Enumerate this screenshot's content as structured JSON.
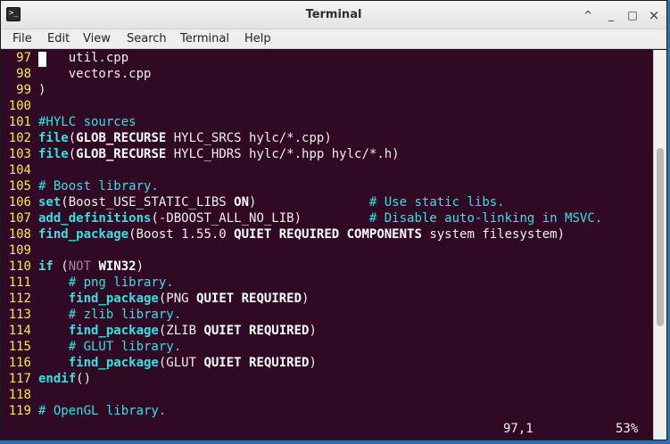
{
  "window": {
    "title": "Terminal",
    "app_icon": ">_"
  },
  "controls": {
    "minimize": "^",
    "maximize": "□",
    "close": "×",
    "restore": "⌃"
  },
  "menu": [
    "File",
    "Edit",
    "View",
    "Search",
    "Terminal",
    "Help"
  ],
  "status": {
    "position": "97,1",
    "percent": "53%"
  },
  "lines": [
    {
      "num": "97",
      "segs": [
        {
          "t": "    util.cpp"
        }
      ]
    },
    {
      "num": "98",
      "segs": [
        {
          "t": "    vectors.cpp"
        }
      ]
    },
    {
      "num": "99",
      "segs": [
        {
          "t": ")"
        }
      ]
    },
    {
      "num": "100",
      "segs": []
    },
    {
      "num": "101",
      "segs": [
        {
          "t": "#HYLC sources",
          "c": "cm"
        }
      ]
    },
    {
      "num": "102",
      "segs": [
        {
          "t": "file",
          "c": "kw"
        },
        {
          "t": "("
        },
        {
          "t": "GLOB_RECURSE",
          "c": "bold"
        },
        {
          "t": " HYLC_SRCS hylc/*.cpp)"
        }
      ]
    },
    {
      "num": "103",
      "segs": [
        {
          "t": "file",
          "c": "kw"
        },
        {
          "t": "("
        },
        {
          "t": "GLOB_RECURSE",
          "c": "bold"
        },
        {
          "t": " HYLC_HDRS hylc/*.hpp hylc/*.h)"
        }
      ]
    },
    {
      "num": "104",
      "segs": []
    },
    {
      "num": "105",
      "segs": [
        {
          "t": "# Boost library.",
          "c": "cm"
        }
      ]
    },
    {
      "num": "106",
      "segs": [
        {
          "t": "set",
          "c": "kw"
        },
        {
          "t": "(Boost_USE_STATIC_LIBS "
        },
        {
          "t": "ON",
          "c": "bold"
        },
        {
          "t": ")               "
        },
        {
          "t": "# Use static libs.",
          "c": "cm"
        }
      ]
    },
    {
      "num": "107",
      "segs": [
        {
          "t": "add_definitions",
          "c": "kw"
        },
        {
          "t": "(-DBOOST_ALL_NO_LIB)         "
        },
        {
          "t": "# Disable auto-linking in MSVC.",
          "c": "cm"
        }
      ]
    },
    {
      "num": "108",
      "segs": [
        {
          "t": "find_package",
          "c": "kw"
        },
        {
          "t": "(Boost 1.55.0 "
        },
        {
          "t": "QUIET REQUIRED COMPONENTS",
          "c": "bold"
        },
        {
          "t": " system filesystem)"
        }
      ]
    },
    {
      "num": "109",
      "segs": []
    },
    {
      "num": "110",
      "segs": [
        {
          "t": "if",
          "c": "kw"
        },
        {
          "t": " ("
        },
        {
          "t": "NOT",
          "c": "neg"
        },
        {
          "t": " "
        },
        {
          "t": "WIN32",
          "c": "bold"
        },
        {
          "t": ")"
        }
      ]
    },
    {
      "num": "111",
      "segs": [
        {
          "t": "    "
        },
        {
          "t": "# png library.",
          "c": "cm"
        }
      ]
    },
    {
      "num": "112",
      "segs": [
        {
          "t": "    "
        },
        {
          "t": "find_package",
          "c": "kw"
        },
        {
          "t": "(PNG "
        },
        {
          "t": "QUIET REQUIRED",
          "c": "bold"
        },
        {
          "t": ")"
        }
      ]
    },
    {
      "num": "113",
      "segs": [
        {
          "t": "    "
        },
        {
          "t": "# zlib library.",
          "c": "cm"
        }
      ]
    },
    {
      "num": "114",
      "segs": [
        {
          "t": "    "
        },
        {
          "t": "find_package",
          "c": "kw"
        },
        {
          "t": "(ZLIB "
        },
        {
          "t": "QUIET REQUIRED",
          "c": "bold"
        },
        {
          "t": ")"
        }
      ]
    },
    {
      "num": "115",
      "segs": [
        {
          "t": "    "
        },
        {
          "t": "# GLUT library.",
          "c": "cm"
        }
      ]
    },
    {
      "num": "116",
      "segs": [
        {
          "t": "    "
        },
        {
          "t": "find_package",
          "c": "kw"
        },
        {
          "t": "(GLUT "
        },
        {
          "t": "QUIET REQUIRED",
          "c": "bold"
        },
        {
          "t": ")"
        }
      ]
    },
    {
      "num": "117",
      "segs": [
        {
          "t": "endif",
          "c": "kw"
        },
        {
          "t": "()"
        }
      ]
    },
    {
      "num": "118",
      "segs": []
    },
    {
      "num": "119",
      "segs": [
        {
          "t": "# OpenGL library.",
          "c": "cm"
        }
      ]
    }
  ]
}
